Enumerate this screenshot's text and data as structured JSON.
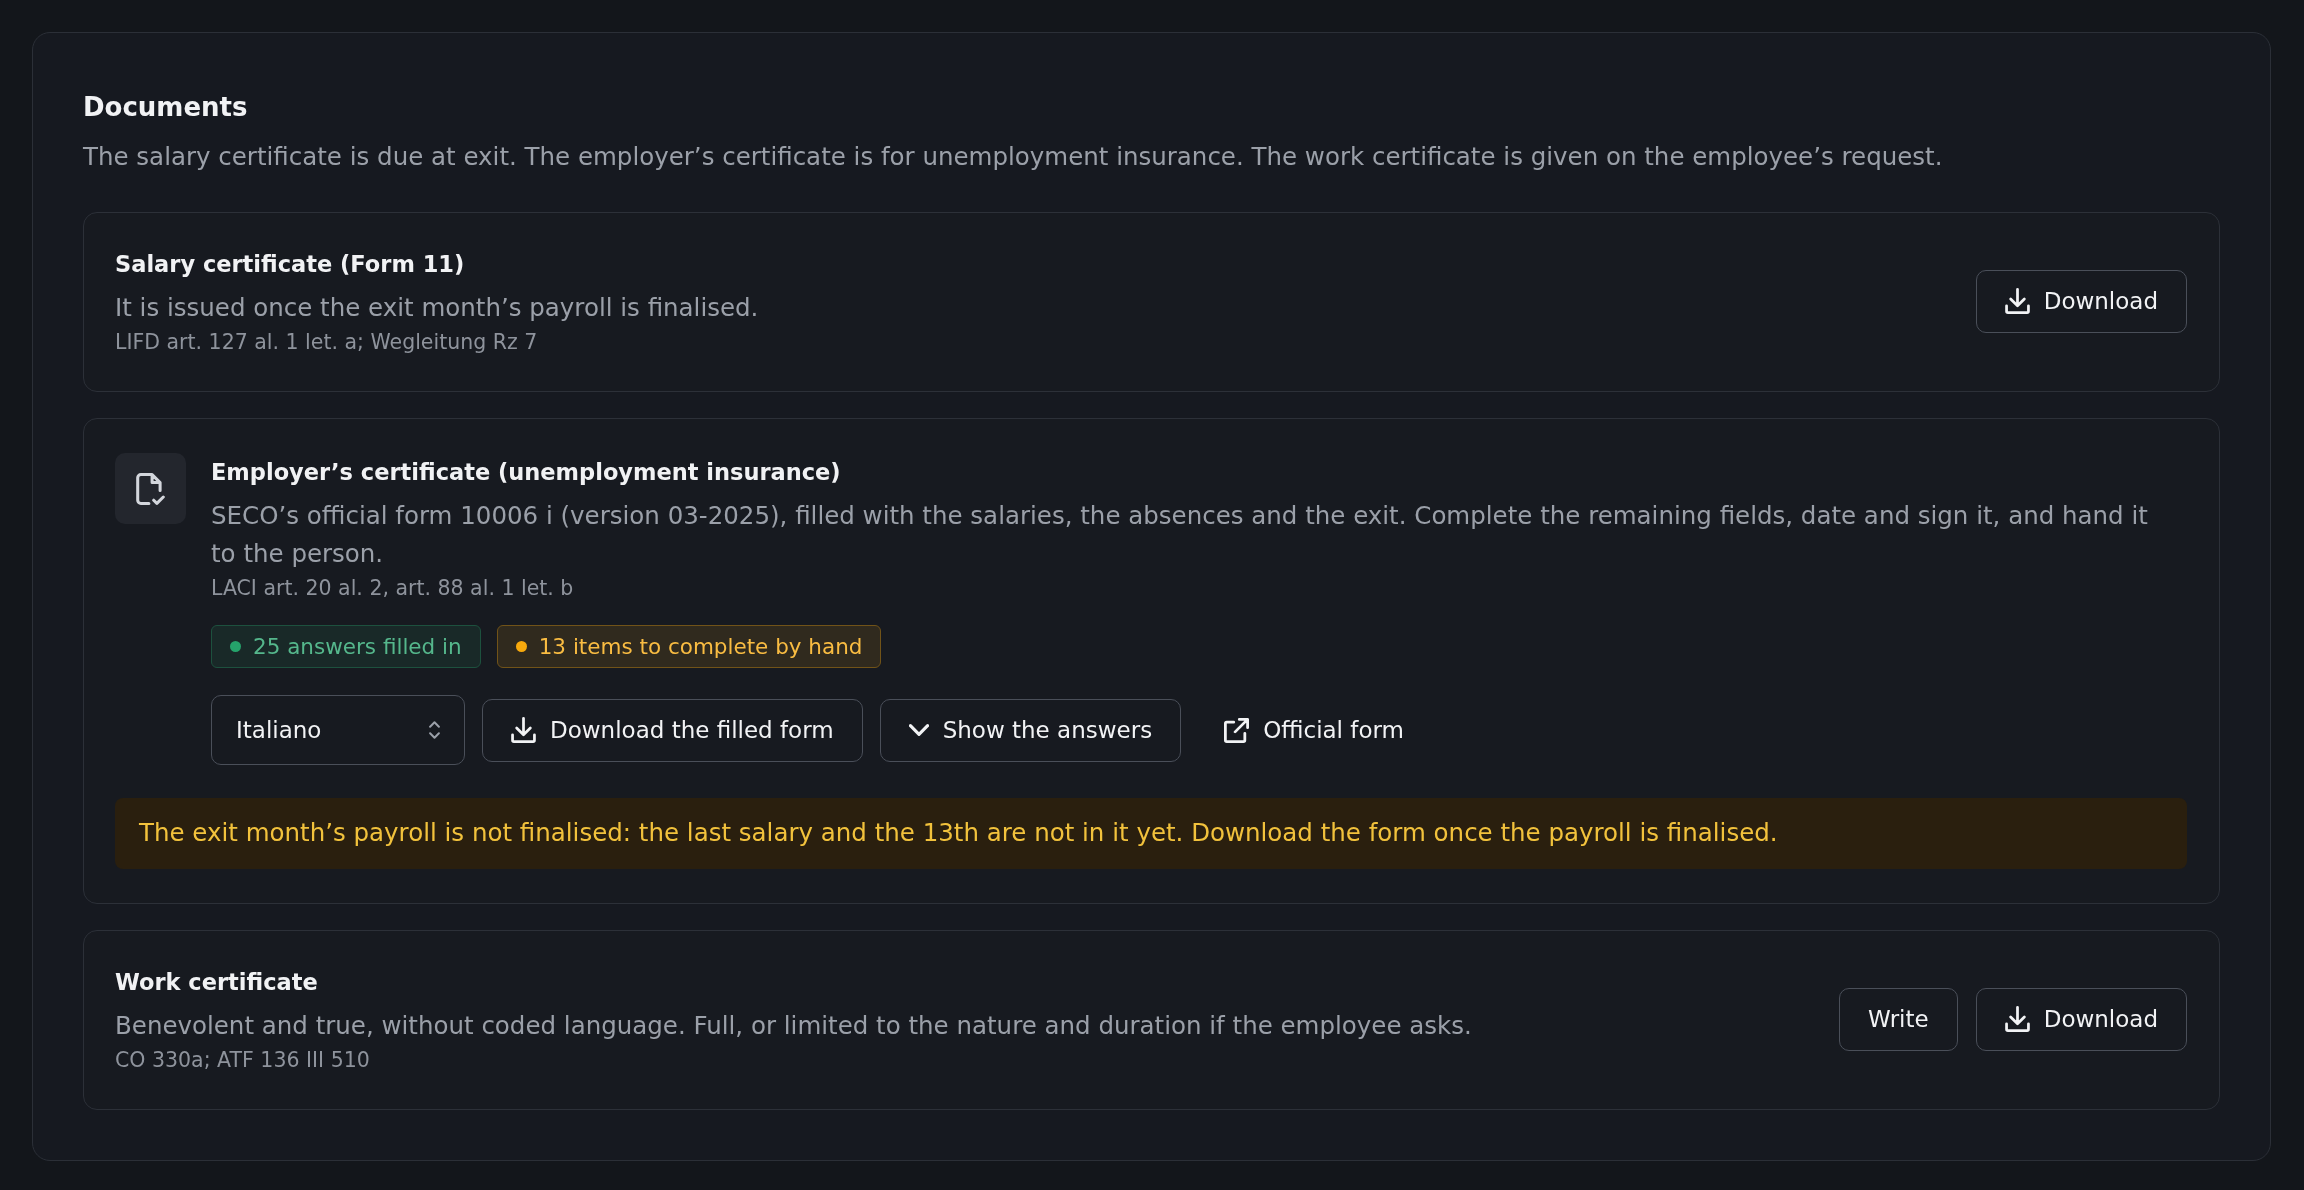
{
  "section": {
    "title": "Documents",
    "description": "The salary certificate is due at exit. The employer’s certificate is for unemployment insurance. The work certificate is given on the employee’s request."
  },
  "documents": [
    {
      "kind": "simple",
      "title": "Salary certificate (Form 11)",
      "description": "It is issued once the exit month’s payroll is finalised.",
      "reference": "LIFD art. 127 al. 1 let. a; Wegleitung Rz 7",
      "actions": [
        {
          "kind": "download",
          "label": "Download"
        }
      ]
    },
    {
      "kind": "form",
      "title": "Employer’s certificate (unemployment insurance)",
      "description": "SECO’s official form 10006 i (version 03-2025), filled with the salaries, the absences and the exit. Complete the remaining fields, date and sign it, and hand it to the person.",
      "reference": "LACI art. 20 al. 2, art. 88 al. 1 let. b",
      "badges": [
        {
          "label": "25 answers filled in",
          "color": "#25a36b"
        },
        {
          "label": "13 items to complete by hand",
          "color": "#f7a90d"
        }
      ],
      "language_select": {
        "value": "Italiano"
      },
      "actions": [
        {
          "kind": "download",
          "label": "Download the filled form"
        },
        {
          "kind": "expand",
          "label": "Show the answers",
          "expanded": false
        },
        {
          "kind": "link",
          "label": "Official form"
        }
      ],
      "warning": "The exit month’s payroll is not finalised: the last salary and the 13th are not in it yet. Download the form once the payroll is finalised."
    },
    {
      "kind": "simple",
      "title": "Work certificate",
      "description": "Benevolent and true, without coded language. Full, or limited to the nature and duration if the employee asks.",
      "reference": "CO 330a; ATF 136 III 510",
      "actions": [
        {
          "kind": "write",
          "label": "Write"
        },
        {
          "kind": "download",
          "label": "Download"
        }
      ]
    }
  ]
}
